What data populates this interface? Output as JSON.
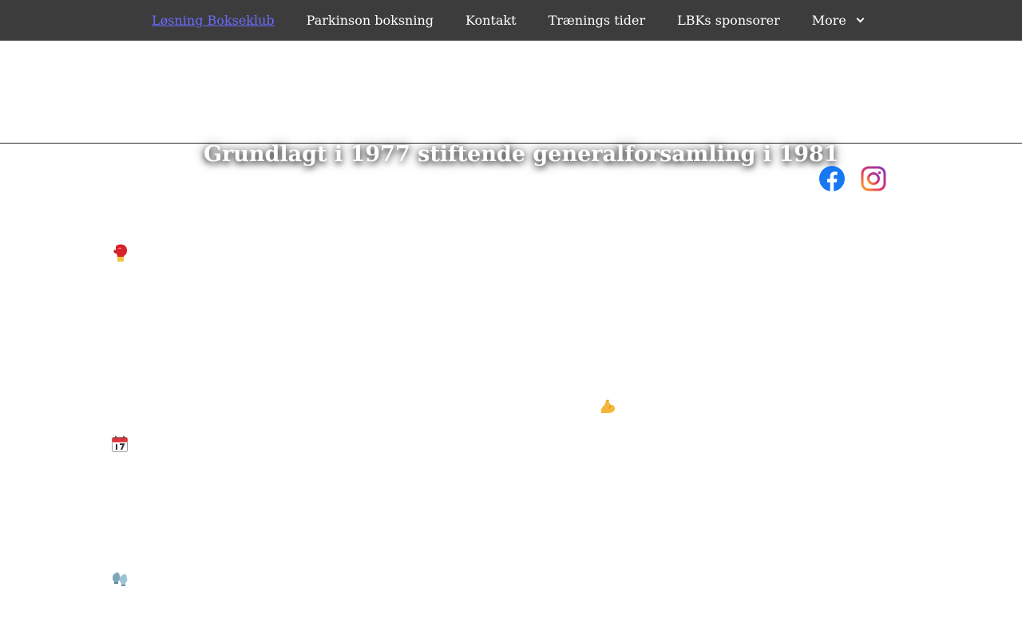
{
  "nav": {
    "items": [
      {
        "label": "Løsning Bokseklub",
        "active": true
      },
      {
        "label": "Parkinson boksning"
      },
      {
        "label": "Kontakt"
      },
      {
        "label": "Trænings tider"
      },
      {
        "label": "LBKs sponsorer"
      },
      {
        "label": "More"
      }
    ],
    "colors": {
      "background": "#3c3c3c",
      "text": "#ffffff",
      "active": "#6a6aff"
    }
  },
  "hero": {
    "tagline": "Grundlagt i 1977 stiftende generalforsamling i 1981"
  },
  "social": [
    {
      "icon": "facebook-icon",
      "color": "#1877f2"
    },
    {
      "icon": "instagram-icon"
    }
  ],
  "icons": [
    "boxing-glove-icon",
    "flexed-biceps-icon",
    "calendar-icon",
    "gloves-icon"
  ]
}
